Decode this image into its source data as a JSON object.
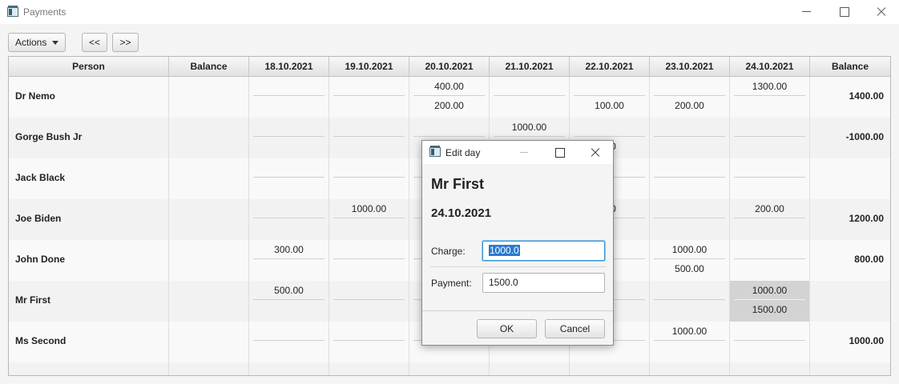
{
  "window": {
    "title": "Payments",
    "icon": "app-icon"
  },
  "toolbar": {
    "actions_label": "Actions",
    "prev_label": "<<",
    "next_label": ">>"
  },
  "table": {
    "columns": [
      "Person",
      "Balance",
      "18.10.2021",
      "19.10.2021",
      "20.10.2021",
      "21.10.2021",
      "22.10.2021",
      "23.10.2021",
      "24.10.2021",
      "Balance"
    ],
    "rows": [
      {
        "person": "Dr Nemo",
        "balance_start": "",
        "days": [
          [
            "",
            ""
          ],
          [
            "",
            ""
          ],
          [
            "400.00",
            "200.00"
          ],
          [
            "",
            ""
          ],
          [
            "",
            "100.00"
          ],
          [
            "",
            "200.00"
          ],
          [
            "1300.00",
            ""
          ]
        ],
        "balance_end": "1400.00"
      },
      {
        "person": "Gorge Bush Jr",
        "balance_start": "",
        "days": [
          [
            "",
            ""
          ],
          [
            "",
            ""
          ],
          [
            "",
            ""
          ],
          [
            "1000.00",
            ""
          ],
          [
            "",
            ".00"
          ],
          [
            "",
            ""
          ],
          [
            "",
            ""
          ]
        ],
        "balance_end": "-1000.00"
      },
      {
        "person": "Jack Black",
        "balance_start": "",
        "days": [
          [
            "",
            ""
          ],
          [
            "",
            ""
          ],
          [
            "",
            ""
          ],
          [
            "",
            ""
          ],
          [
            "",
            ""
          ],
          [
            "",
            ""
          ],
          [
            "",
            ""
          ]
        ],
        "balance_end": ""
      },
      {
        "person": "Joe Biden",
        "balance_start": "",
        "days": [
          [
            "",
            ""
          ],
          [
            "1000.00",
            ""
          ],
          [
            "",
            ""
          ],
          [
            "",
            ""
          ],
          [
            ".00",
            ""
          ],
          [
            "",
            ""
          ],
          [
            "200.00",
            ""
          ]
        ],
        "balance_end": "1200.00"
      },
      {
        "person": "John Done",
        "balance_start": "",
        "days": [
          [
            "300.00",
            ""
          ],
          [
            "",
            ""
          ],
          [
            "",
            ""
          ],
          [
            "",
            ""
          ],
          [
            "",
            ""
          ],
          [
            "1000.00",
            "500.00"
          ],
          [
            "",
            ""
          ]
        ],
        "balance_end": "800.00"
      },
      {
        "person": "Mr First",
        "balance_start": "",
        "days": [
          [
            "500.00",
            ""
          ],
          [
            "",
            ""
          ],
          [
            "",
            ""
          ],
          [
            "",
            ""
          ],
          [
            "",
            ""
          ],
          [
            "",
            ""
          ],
          [
            "1000.00",
            "1500.00"
          ]
        ],
        "balance_end": ""
      },
      {
        "person": "Ms Second",
        "balance_start": "",
        "days": [
          [
            "",
            ""
          ],
          [
            "",
            ""
          ],
          [
            "",
            ""
          ],
          [
            "",
            ""
          ],
          [
            "",
            ""
          ],
          [
            "1000.00",
            ""
          ],
          [
            "",
            ""
          ]
        ],
        "balance_end": "1000.00"
      }
    ]
  },
  "dialog": {
    "title": "Edit day",
    "person": "Mr First",
    "date": "24.10.2021",
    "charge_label": "Charge:",
    "charge_value": "1000.0",
    "payment_label": "Payment:",
    "payment_value": "1500.0",
    "ok_label": "OK",
    "cancel_label": "Cancel"
  }
}
